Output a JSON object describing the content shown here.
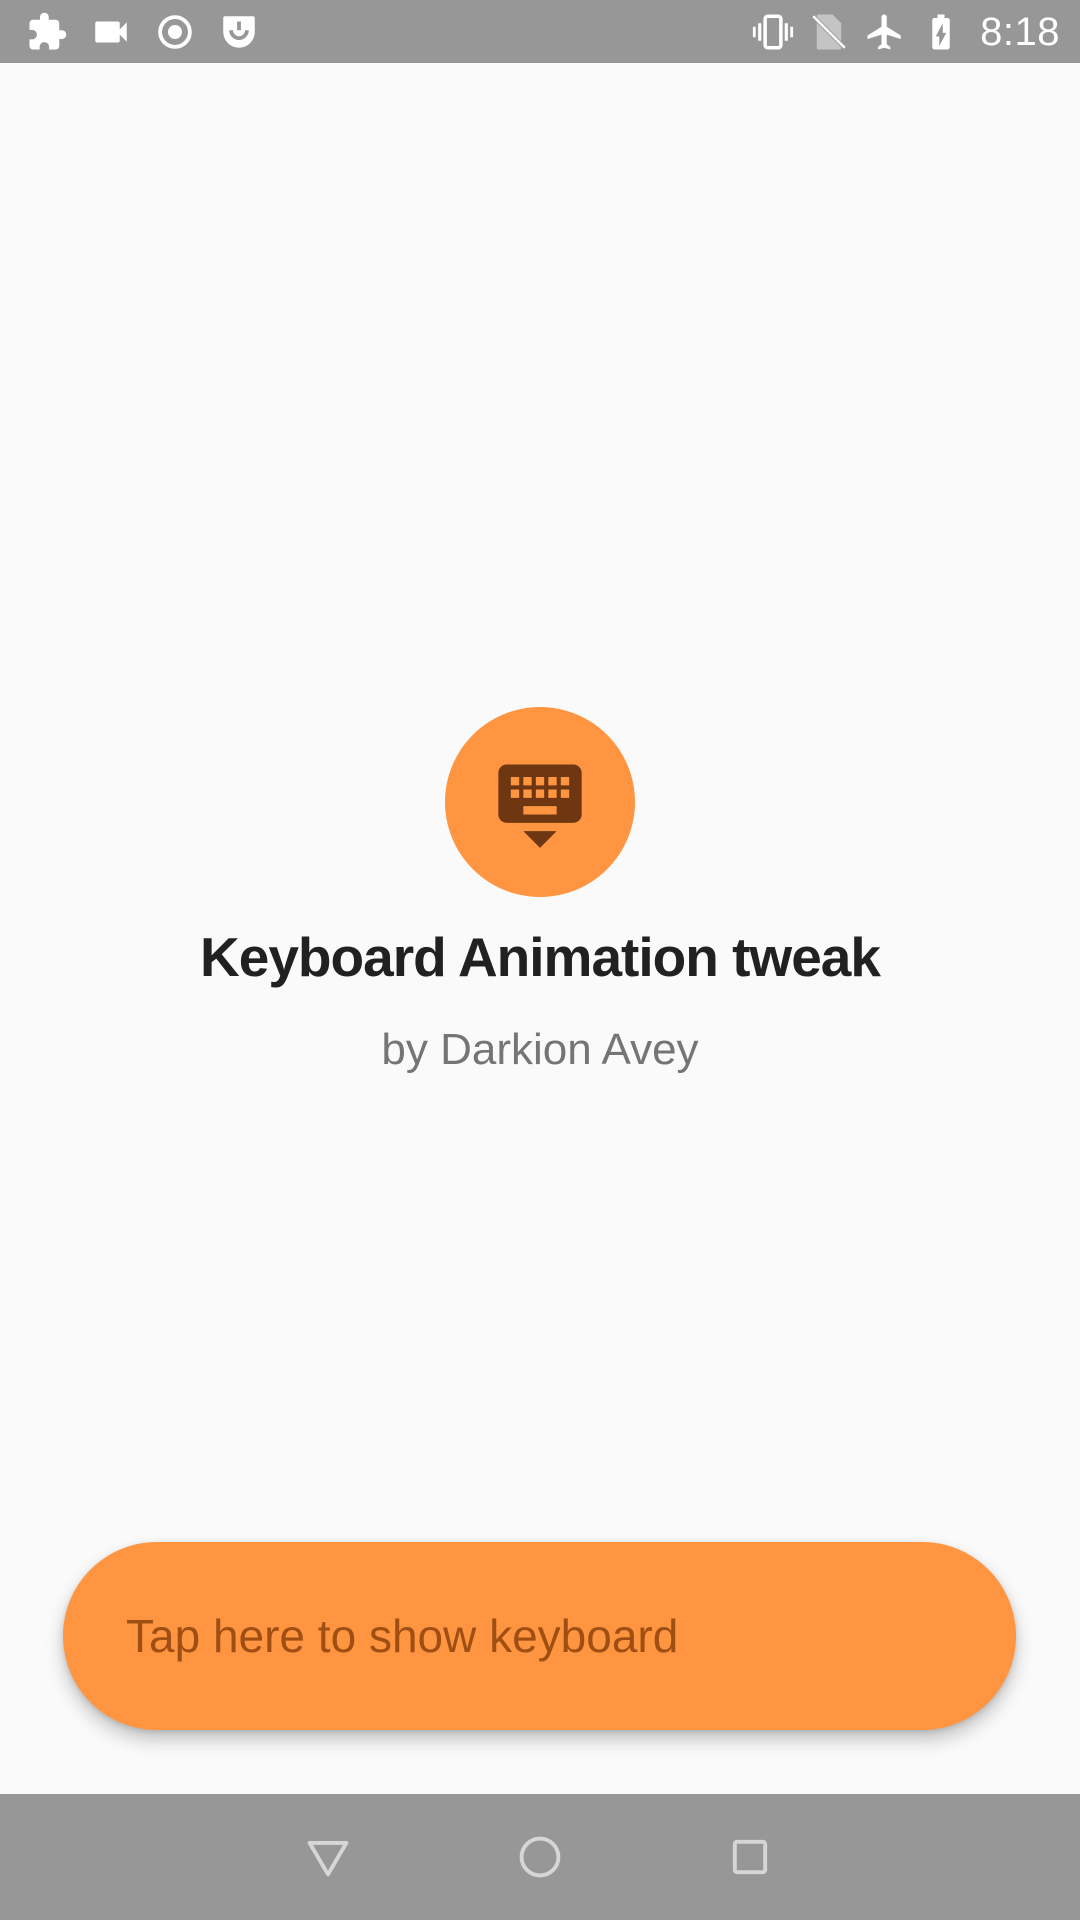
{
  "status_bar": {
    "time": "8:18",
    "left_icons": [
      "puzzle-icon",
      "video-camera-icon",
      "record-icon",
      "grab-icon"
    ],
    "right_icons": [
      "vibrate-icon",
      "no-sim-icon",
      "airplane-mode-icon",
      "battery-charging-icon"
    ]
  },
  "main": {
    "logo_icon": "keyboard-hide-icon",
    "title": "Keyboard Animation tweak",
    "subtitle": "by Darkion Avey"
  },
  "action": {
    "button_label": "Tap here to show keyboard"
  },
  "nav_bar": {
    "buttons": [
      "back-triangle-icon",
      "home-circle-icon",
      "recents-square-icon"
    ]
  },
  "colors": {
    "accent": "#ff9540",
    "accent_dark": "#6e3712",
    "button_text": "#a04f14",
    "background": "#fafafa",
    "system_bars": "#979797"
  }
}
